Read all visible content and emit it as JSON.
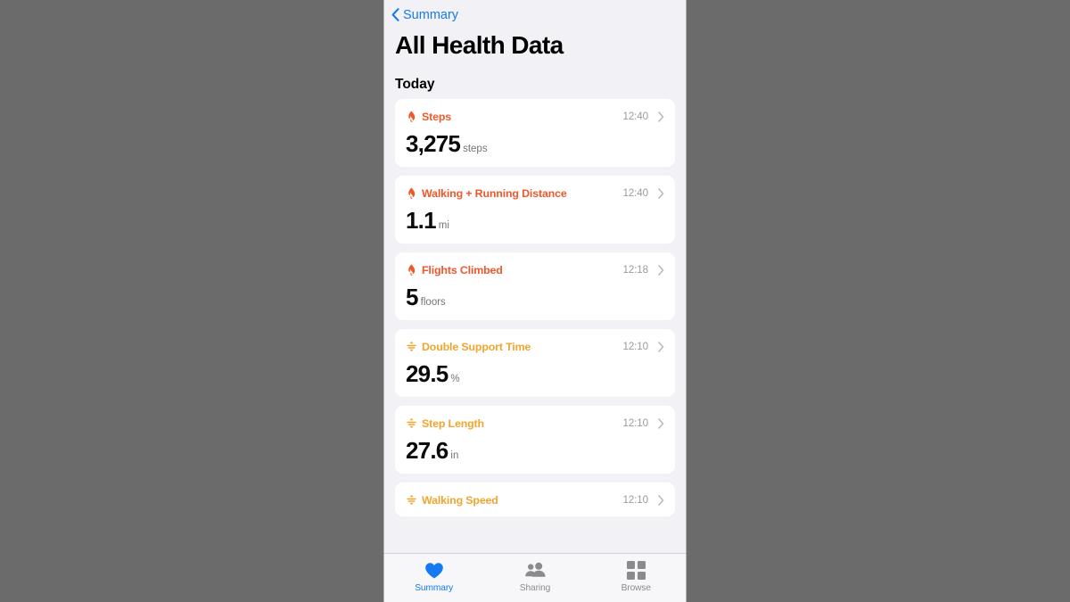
{
  "nav": {
    "back_label": "Summary",
    "back_icon": "chevron-left-icon"
  },
  "header": {
    "title": "All Health Data",
    "section": "Today"
  },
  "colors": {
    "fitness": "#f0572b",
    "mobility": "#f2a52e",
    "accent": "#1579f2",
    "page_bg": "#f2f1f6",
    "card_bg": "#ffffff",
    "backdrop": "#6b6b6b"
  },
  "cards": [
    {
      "label": "Steps",
      "icon": "flame-icon",
      "category": "fitness",
      "time": "12:40",
      "value": "3,275",
      "unit": "steps",
      "chevron": "chevron-right-icon"
    },
    {
      "label": "Walking + Running Distance",
      "icon": "flame-icon",
      "category": "fitness",
      "time": "12:40",
      "value": "1.1",
      "unit": "mi",
      "chevron": "chevron-right-icon"
    },
    {
      "label": "Flights Climbed",
      "icon": "flame-icon",
      "category": "fitness",
      "time": "12:18",
      "value": "5",
      "unit": "floors",
      "chevron": "chevron-right-icon"
    },
    {
      "label": "Double Support Time",
      "icon": "gait-icon",
      "category": "mobility",
      "time": "12:10",
      "value": "29.5",
      "unit": "%",
      "chevron": "chevron-right-icon"
    },
    {
      "label": "Step Length",
      "icon": "gait-icon",
      "category": "mobility",
      "time": "12:10",
      "value": "27.6",
      "unit": "in",
      "chevron": "chevron-right-icon"
    },
    {
      "label": "Walking Speed",
      "icon": "gait-icon",
      "category": "mobility",
      "time": "12:10",
      "value": "",
      "unit": "",
      "chevron": "chevron-right-icon"
    }
  ],
  "tabbar": {
    "items": [
      {
        "label": "Summary",
        "icon": "heart-icon",
        "active": true
      },
      {
        "label": "Sharing",
        "icon": "people-icon",
        "active": false
      },
      {
        "label": "Browse",
        "icon": "grid-icon",
        "active": false
      }
    ]
  }
}
